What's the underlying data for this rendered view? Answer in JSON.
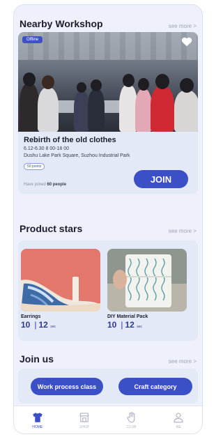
{
  "workshop_section": {
    "title": "Nearby Workshop",
    "see_more": "see more >"
  },
  "workshop": {
    "badge": "Offline",
    "title": "Rebirth of the old clothes",
    "time": "6.12-6.30  8   00-18   00",
    "address": "Dushu Lake Park Square, Suzhou Industrial Park",
    "tag": "50 points",
    "joined_prefix": "Have joined",
    "joined_count": "60 people",
    "join_label": "JOIN"
  },
  "products_section": {
    "title": "Product stars",
    "see_more": "see more >"
  },
  "products": [
    {
      "name": "Earrings",
      "price": "10",
      "stock": "12",
      "unit": "sec"
    },
    {
      "name": "DIY Material Pack",
      "price": "10",
      "stock": "12",
      "unit": "sec"
    }
  ],
  "joinus_section": {
    "title": "Join us",
    "see_more": "see more >",
    "pill_1": "Work process class",
    "pill_2": "Craft category"
  },
  "nav": {
    "home": "HOME",
    "shop": "SHOP",
    "club": "CLUB",
    "me": "ME"
  },
  "colors": {
    "accent": "#3b4fc7",
    "background": "#eef1fb",
    "card": "#e4e9f7"
  }
}
